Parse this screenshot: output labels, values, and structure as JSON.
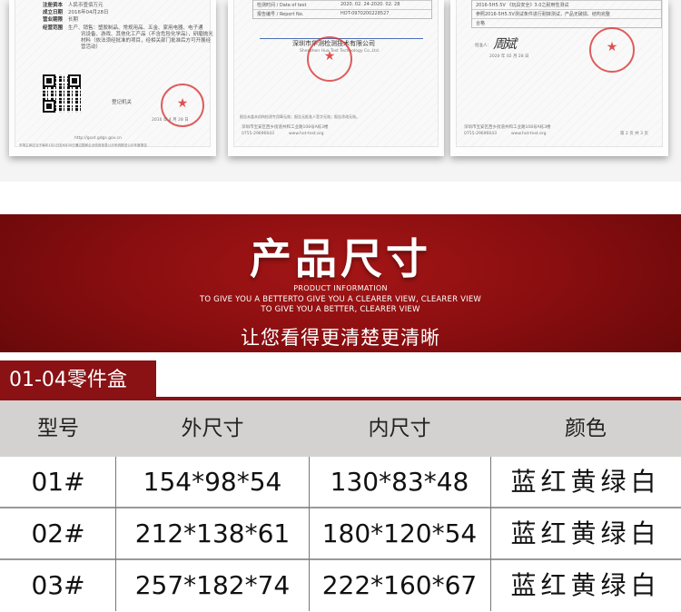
{
  "certificates": {
    "business_license": {
      "fields": [
        {
          "label": "注册资本",
          "value": "人民币壹佰万元"
        },
        {
          "label": "成立日期",
          "value": "2016年04月28日"
        },
        {
          "label": "营业期限",
          "value": "长期"
        },
        {
          "label": "经营范围",
          "value": "生产、销售：塑胶制品、常规用品、五金、家用电器、电子通"
        }
      ],
      "scope_lines": [
        "讯设备、游戏、其他化工产品（不含危险化学品），研磨抛光",
        "材料（依法须经批准的项目，经相关部门批准后方可开展经",
        "营活动）"
      ],
      "authority": "登记机关",
      "date": "2016 年 4 月 28 日",
      "url": "http://gsxt.gdgs.gov.cn",
      "footer": "市场主体应当于每年1月1日至6月30日通过国家企业信用信息公示系统报送公示年度报告"
    },
    "test_report": {
      "rows": [
        {
          "label": "检测时间 / Date of test",
          "value": "2020. 02. 24-2020. 02. 28"
        },
        {
          "label": "报告编号 / Report No.",
          "value": "HOT-0970200228527"
        }
      ],
      "company": "深圳市华测检测技术有限公司",
      "company_en": "Shenzhen Hua Test Technology Co.,Ltd.",
      "note": "报告未盖本机构检测专用章无效；报告无批准人签字无效；报告涂改无效。",
      "address": "深圳市宝安区西乡街道共和工业路108号A栋3楼",
      "phone": "0755-29696643",
      "web": "www.hot-test.org"
    },
    "test_detail": {
      "lines": [
        "2016-5H5.5V  《玩具安全》3.0之耐用性测试",
        "参照2016-5H5.5V测试条件进行耐摔测试，产品无破损、结构完整",
        "合格"
      ],
      "signer_label": "批准人：",
      "signature": "周斌",
      "date": "2020 年 02 月 28 日",
      "page": "第 2 页 共 3 页",
      "address": "深圳市宝安区西乡街道共和工业路108号A栋3楼",
      "phone": "0755-29696643",
      "web": "www.hot-test.org"
    }
  },
  "banner": {
    "title": "产品尺寸",
    "subtitle": "PRODUCT INFORMATION",
    "line1": "TO GIVE YOU A BETTERTO GIVE YOU A  CLEARER VIEW, CLEARER VIEW",
    "line2": "TO GIVE YOU A BETTER, CLEARER VIEW",
    "tagline": "让您看得更清楚更清晰"
  },
  "table": {
    "section_label": "01-04零件盒",
    "headers": [
      "型号",
      "外尺寸",
      "内尺寸",
      "颜色"
    ],
    "rows": [
      {
        "model": "01#",
        "outer": "154*98*54",
        "inner": "130*83*48",
        "colors": "蓝红黄绿白"
      },
      {
        "model": "02#",
        "outer": "212*138*61",
        "inner": "180*120*54",
        "colors": "蓝红黄绿白"
      },
      {
        "model": "03#",
        "outer": "257*182*74",
        "inner": "222*160*67",
        "colors": "蓝红黄绿白"
      }
    ]
  },
  "colors": {
    "banner_red": "#8a0e10",
    "label_red": "#8a1114",
    "header_gray": "#d4d2d1"
  }
}
